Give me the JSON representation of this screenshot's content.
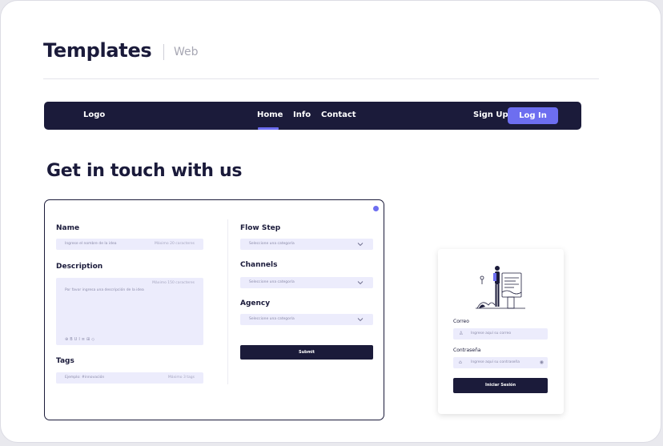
{
  "header": {
    "title": "Templates",
    "subtitle": "Web"
  },
  "nav": {
    "logo": "Logo",
    "links": [
      "Home",
      "Info",
      "Contact"
    ],
    "active_link": "Home",
    "signup": "Sign Up",
    "login": "Log In"
  },
  "heading": "Get in touch with us",
  "form": {
    "name_label": "Name",
    "name_placeholder": "Ingrese el nombre de la idea",
    "name_counter": "Máximo 20 caracteres",
    "description_label": "Description",
    "description_placeholder": "Por favor ingresa una descripción de la idea",
    "description_counter": "Máximo 150 caracteres",
    "toolbar_icons": [
      "link-icon",
      "bold-icon",
      "underline-icon",
      "italic-icon",
      "list-icon",
      "table-icon",
      "code-icon"
    ],
    "tags_label": "Tags",
    "tags_placeholder": "Ejemplo: #innovación",
    "tags_counter": "Máximo 3 tags",
    "flowstep_label": "Flow Step",
    "flowstep_value": "Seleccione una categoría",
    "channels_label": "Channels",
    "channels_value": "Seleccione una categoría",
    "agency_label": "Agency",
    "agency_value": "Seleccione una categoría",
    "submit": "Submit"
  },
  "login_card": {
    "correo_label": "Correo",
    "correo_placeholder": "Ingrese aquí su correo",
    "password_label": "Contraseña",
    "password_placeholder": "Ingrese aquí su contraseña",
    "button": "Iniciar Sesión"
  },
  "colors": {
    "navy": "#1b1b3a",
    "accent": "#6d6ef0",
    "field": "#ececfc"
  }
}
